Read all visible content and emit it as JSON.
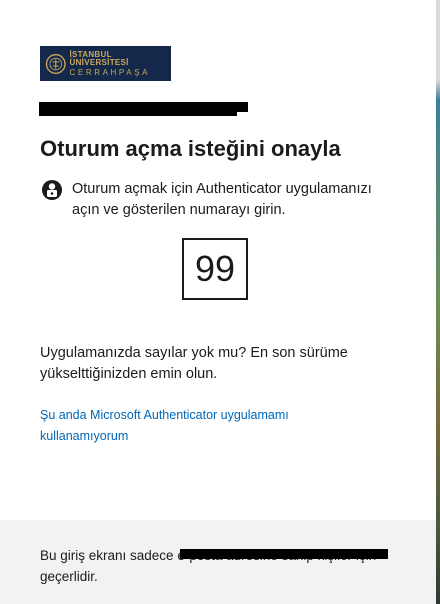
{
  "org": {
    "logo_line1": "İSTANBUL ÜNİVERSİTESİ",
    "logo_line2": "CERRAHPAŞA"
  },
  "heading": {
    "title": "Oturum açma isteğini onayla"
  },
  "instructions": {
    "icon": "authenticator-lock-icon",
    "text": "Oturum açmak için Authenticator uygulamanızı açın ve gösterilen numarayı girin."
  },
  "code": {
    "number": "99"
  },
  "hint": {
    "text": "Uygulamanızda sayılar yok mu? En son sürüme yükselttiğinizden emin olun."
  },
  "alternative": {
    "link_text": "Şu anda Microsoft Authenticator uygulamamı kullanamıyorum"
  },
  "footer": {
    "text": "Bu giriş ekranı sadece                                         e-posta adresine sahip kişiler için geçerlidir.",
    "background": "#f2f2f2"
  },
  "colors": {
    "link": "#0067b8",
    "logo_bg": "#13284b",
    "logo_gold": "#c9a85a"
  }
}
